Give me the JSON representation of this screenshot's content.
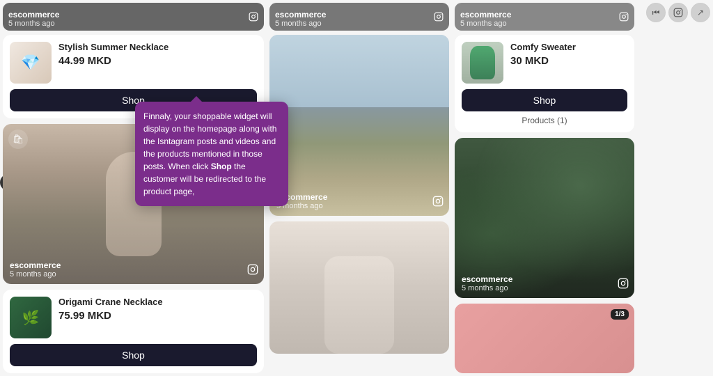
{
  "topRow": [
    {
      "username": "escommerce",
      "timestamp": "5 months ago",
      "bg": "#555"
    },
    {
      "username": "escommerce",
      "timestamp": "5 months ago",
      "bg": "#666"
    },
    {
      "username": "escommerce",
      "timestamp": "5 months ago",
      "bg": "#777"
    }
  ],
  "leftCol": {
    "productCard1": {
      "name": "Stylish Summer Necklace",
      "price": "44.99 MKD",
      "shopLabel": "Shop"
    },
    "postCard1": {
      "username": "escommerce",
      "timestamp": "5 months ago"
    },
    "productCard2": {
      "name": "Origami Crane Necklace",
      "price": "75.99 MKD",
      "shopLabel": "Shop"
    }
  },
  "midCol": {
    "postCard1": {
      "username": "escommerce",
      "timestamp": "5 months ago"
    },
    "postCard2": {
      "username": "",
      "timestamp": ""
    }
  },
  "rightCol": {
    "productCard1": {
      "name": "Comfy Sweater",
      "price": "30 MKD",
      "shopLabel": "Shop",
      "productsLink": "Products (1)"
    },
    "postCard1": {
      "username": "escommerce",
      "timestamp": "5 months ago"
    },
    "postCard2": {
      "badge": "1/3"
    }
  },
  "tooltip": {
    "text1": "Finnaly, your shoppable widget will display on the homepage along with the Isntagram posts and videos and the products mentioned in those posts. When click ",
    "bold": "Shop",
    "text2": " the customer will be redirected to the product page,"
  },
  "controls": {
    "rewind": "⏮",
    "instagram": "📷",
    "share": "↗"
  },
  "sidebarIcon": "c"
}
